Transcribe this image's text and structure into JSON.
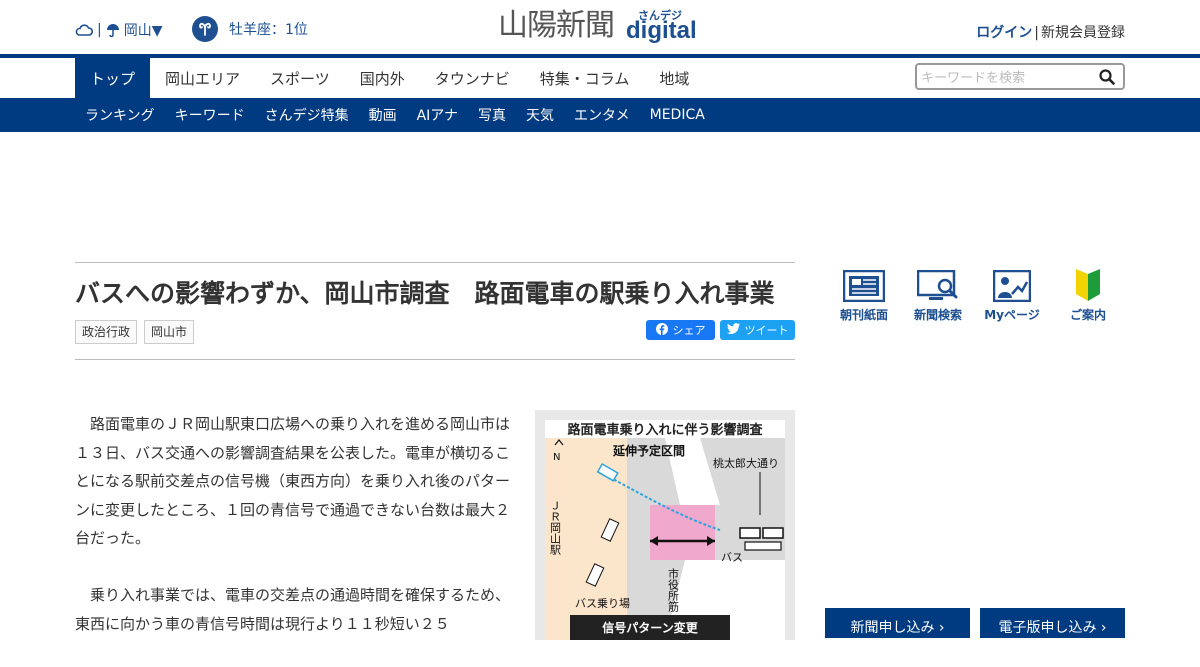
{
  "header": {
    "weather_region": "岡山▼",
    "weather_icons": [
      "cloud-icon",
      "umbrella-icon"
    ],
    "horoscope": "牡羊座：1位",
    "logo_text": "山陽新聞",
    "logo_sub": "さんデジ",
    "logo_digital": "digital",
    "login": "ログイン",
    "register": "新規会員登録"
  },
  "nav": {
    "main_items": [
      "トップ",
      "岡山エリア",
      "スポーツ",
      "国内外",
      "タウンナビ",
      "特集・コラム",
      "地域"
    ],
    "search_placeholder": "キーワードを検索",
    "sub_items": [
      "ランキング",
      "キーワード",
      "さんデジ特集",
      "動画",
      "AIアナ",
      "写真",
      "天気",
      "エンタメ",
      "MEDICA"
    ]
  },
  "article": {
    "title": "バスへの影響わずか、岡山市調査　路面電車の駅乗り入れ事業",
    "tags": [
      "政治行政",
      "岡山市"
    ],
    "share_fb": "シェア",
    "share_tw": "ツイート",
    "paragraphs": [
      "路面電車のＪＲ岡山駅東口広場への乗り入れを進める岡山市は１３日、バス交通への影響調査結果を公表した。電車が横切ることになる駅前交差点の信号機（東西方向）を乗り入れ後のパターンに変更したところ、１回の青信号で通過できない台数は最大２台だった。",
      "乗り入れ事業では、電車の交差点の通過時間を確保するため、東西に向かう車の青信号時間は現行より１１秒短い２５"
    ]
  },
  "figure": {
    "title": "路面電車乗り入れに伴う影響調査",
    "label_extension": "延伸予定区間",
    "label_momotaro": "桃太郎大通り",
    "label_jr": "ＪＲ岡山駅",
    "label_bus": "バス",
    "label_city_hall": "市役所筋",
    "label_bus_stop": "バス乗り場",
    "label_signal": "信号パターン変更",
    "north": "N"
  },
  "sidebar": {
    "icons": [
      {
        "label": "朝刊紙面",
        "icon": "newspaper-icon"
      },
      {
        "label": "新聞検索",
        "icon": "search-monitor-icon"
      },
      {
        "label": "Myページ",
        "icon": "person-chart-icon"
      },
      {
        "label": "ご案内",
        "icon": "beginner-mark-icon"
      }
    ],
    "btn_newspaper": "新聞申し込み ›",
    "btn_digital": "電子版申し込み ›"
  },
  "colors": {
    "brand_navy": "#003a80",
    "link_blue": "#1d4f91",
    "facebook": "#1877f2",
    "twitter": "#1da1f2"
  }
}
